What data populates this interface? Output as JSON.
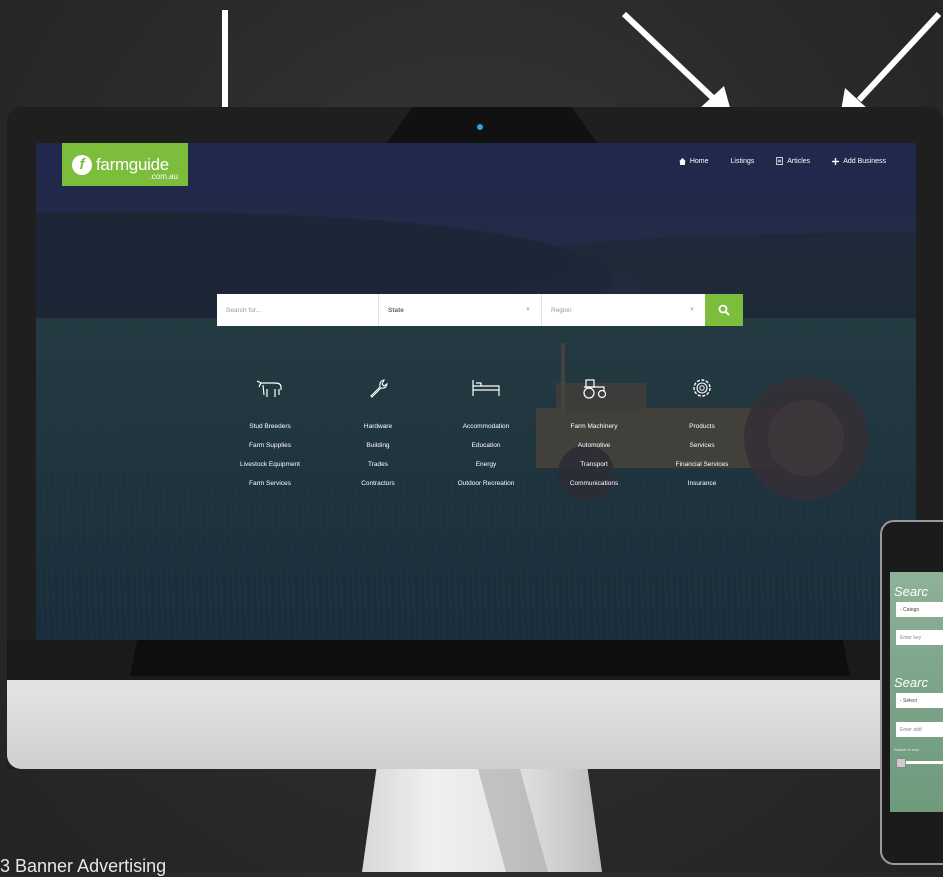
{
  "site": {
    "logo_text": "farmguide",
    "logo_sub": ".com.au",
    "logo_mark": "f"
  },
  "nav": [
    {
      "label": "Home",
      "icon": "home-icon"
    },
    {
      "label": "Listings",
      "icon": ""
    },
    {
      "label": "Articles",
      "icon": "document-icon"
    },
    {
      "label": "Add Business",
      "icon": "plus-icon"
    }
  ],
  "search": {
    "placeholder": "Search for...",
    "state_label": "State",
    "region_label": "Region",
    "button_icon": "search-icon"
  },
  "categories": [
    {
      "icon": "cow-icon",
      "items": [
        "Stud Breeders",
        "Farm Supplies",
        "Livestock Equipment",
        "Farm Services"
      ]
    },
    {
      "icon": "wrench-icon",
      "items": [
        "Hardware",
        "Building",
        "Trades",
        "Contractors"
      ]
    },
    {
      "icon": "bed-icon",
      "items": [
        "Accommodation",
        "Education",
        "Energy",
        "Outdoor Recreation"
      ]
    },
    {
      "icon": "tractor-icon",
      "items": [
        "Farm Machinery",
        "Automotive",
        "Transport",
        "Communications"
      ]
    },
    {
      "icon": "gear-icon",
      "items": [
        "Products",
        "Services",
        "Financial Services",
        "Insurance"
      ]
    }
  ],
  "phone": {
    "title1": "Searc",
    "field1": "- Catego",
    "field2": "Enter key",
    "title2": "Searc",
    "field3": "- Select",
    "field4": "Enter add",
    "small": "Search in radi"
  },
  "caption": "3 Banner Advertising",
  "colors": {
    "accent": "#7cbd3b",
    "overlay": "#1c2250"
  }
}
